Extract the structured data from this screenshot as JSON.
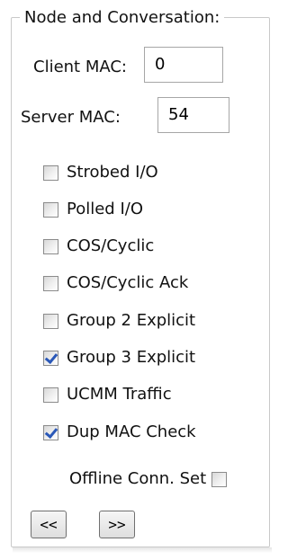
{
  "group": {
    "title": "Node and Conversation:"
  },
  "client_mac": {
    "label": "Client MAC:",
    "value": "0"
  },
  "server_mac": {
    "label": "Server MAC:",
    "value": "54"
  },
  "options": [
    {
      "label": "Strobed I/O",
      "checked": false
    },
    {
      "label": "Polled I/O",
      "checked": false
    },
    {
      "label": "COS/Cyclic",
      "checked": false
    },
    {
      "label": "COS/Cyclic Ack",
      "checked": false
    },
    {
      "label": "Group 2 Explicit",
      "checked": false
    },
    {
      "label": "Group 3 Explicit",
      "checked": true
    },
    {
      "label": "UCMM Traffic",
      "checked": false
    },
    {
      "label": "Dup MAC Check",
      "checked": true
    }
  ],
  "offline_conn_set": {
    "label": "Offline Conn. Set",
    "checked": false
  },
  "nav": {
    "prev_label": "<<",
    "next_label": ">>"
  },
  "colors": {
    "check_mark": "#2a58b8",
    "border": "#c9c9c9"
  }
}
